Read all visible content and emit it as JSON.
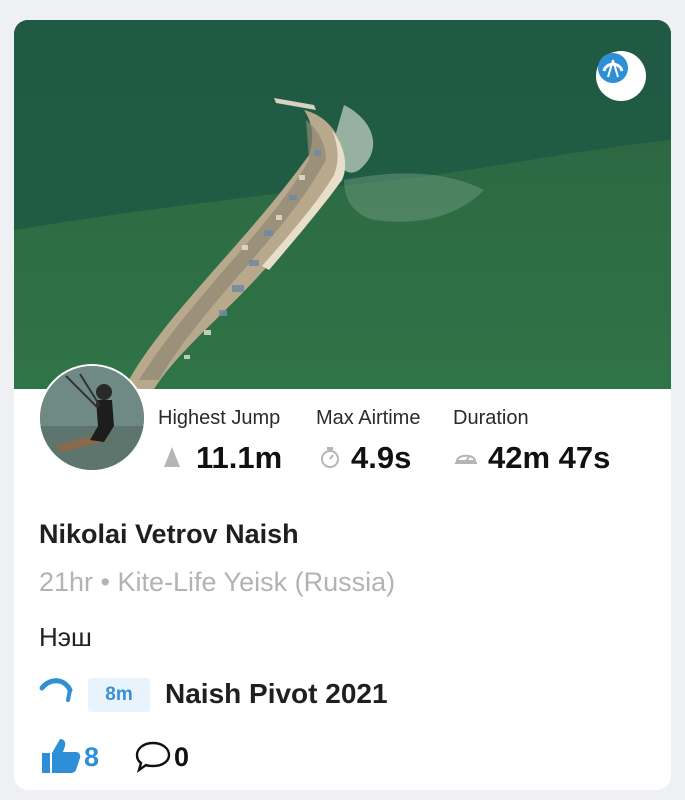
{
  "session": {
    "stats": [
      {
        "label": "Highest Jump",
        "value": "11.1m",
        "icon": "arrow-up-icon"
      },
      {
        "label": "Max Airtime",
        "value": "4.9s",
        "icon": "stopwatch-icon"
      },
      {
        "label": "Duration",
        "value": "42m 47s",
        "icon": "duration-icon"
      }
    ],
    "rider_name": "Nikolai Vetrov Naish",
    "meta": "21hr • Kite-Life Yeisk (Russia)",
    "description": "Нэш",
    "kite_size": "8m",
    "gear_name": "Naish Pivot 2021",
    "likes": "8",
    "comments": "0"
  },
  "colors": {
    "accent": "#2e8fd6",
    "muted_text": "#b3b3b3",
    "size_badge_bg": "#e8f3fb"
  },
  "icons": {
    "map_badge": "kite-logo-icon",
    "kite": "kite-icon",
    "like": "thumbs-up-icon",
    "comment": "speech-bubble-icon"
  }
}
